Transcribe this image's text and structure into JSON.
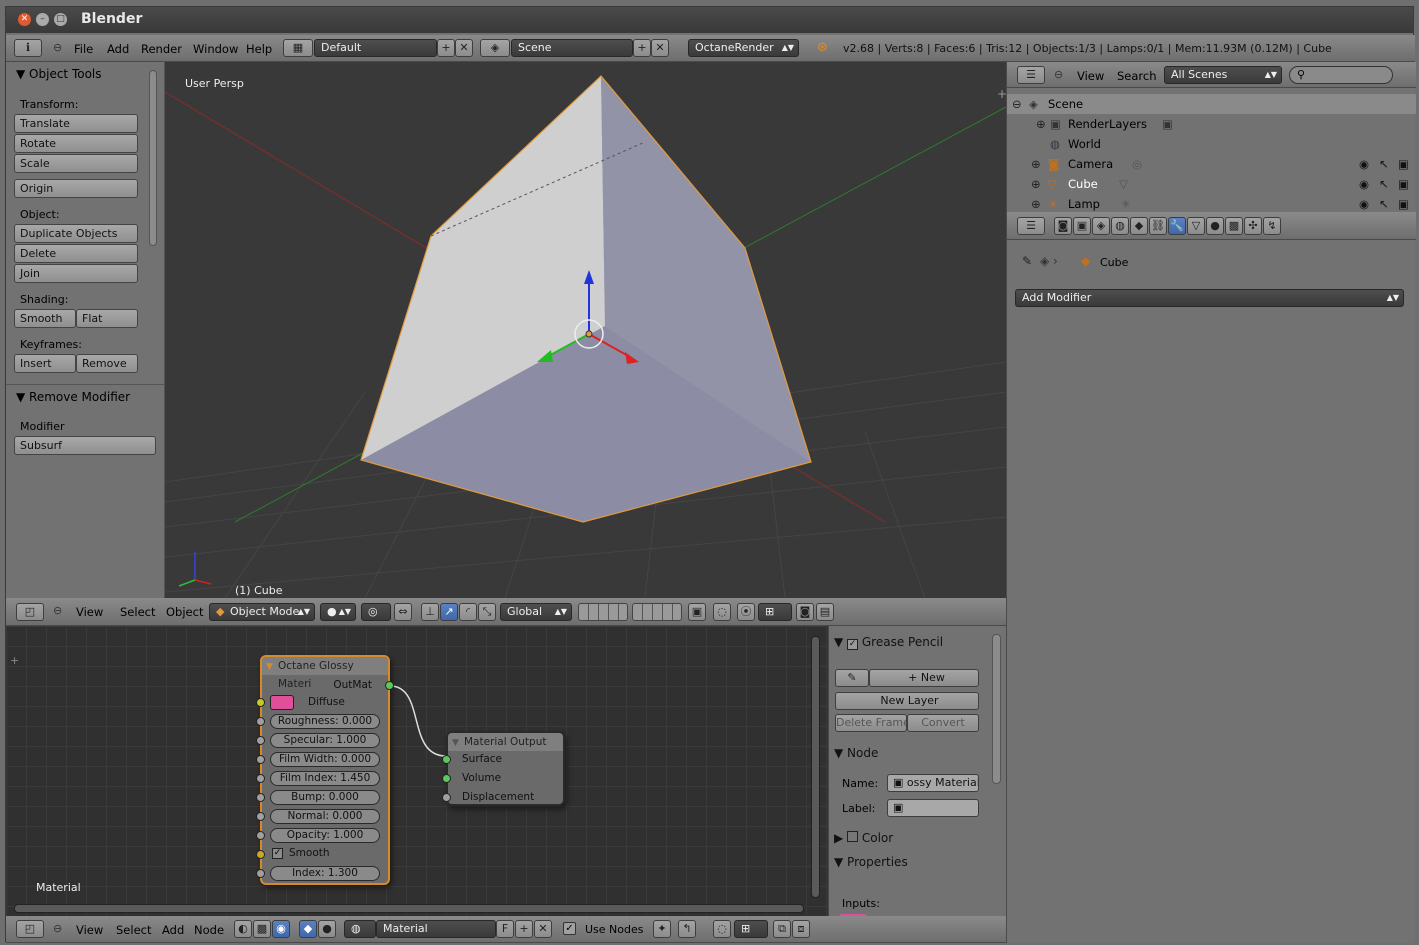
{
  "window": {
    "title": "Blender"
  },
  "infobar": {
    "menus": [
      "File",
      "Add",
      "Render",
      "Window",
      "Help"
    ],
    "screen_layout": "Default",
    "scene": "Scene",
    "render_engine": "OctaneRender",
    "stats": "v2.68 | Verts:8 | Faces:6 | Tris:12 | Objects:1/3 | Lamps:0/1 | Mem:11.93M (0.12M) | Cube"
  },
  "toolshelf": {
    "panel_title": "Object Tools",
    "transform_label": "Transform:",
    "translate": "Translate",
    "rotate": "Rotate",
    "scale": "Scale",
    "origin": "Origin",
    "object_label": "Object:",
    "duplicate": "Duplicate Objects",
    "delete": "Delete",
    "join": "Join",
    "shading_label": "Shading:",
    "smooth": "Smooth",
    "flat": "Flat",
    "keyframes_label": "Keyframes:",
    "insert": "Insert",
    "remove": "Remove",
    "operator_panel_title": "Remove Modifier",
    "modifier_label": "Modifier",
    "modifier_value": "Subsurf"
  },
  "viewport": {
    "view_label": "User Persp",
    "object_label": "(1) Cube",
    "header": {
      "menus": [
        "View",
        "Select",
        "Object"
      ],
      "mode": "Object Mode",
      "orientation": "Global"
    }
  },
  "outliner": {
    "menus": [
      "View",
      "Search"
    ],
    "display_mode": "All Scenes",
    "search_placeholder": "",
    "items": [
      {
        "name": "Scene"
      },
      {
        "name": "RenderLayers"
      },
      {
        "name": "World"
      },
      {
        "name": "Camera"
      },
      {
        "name": "Cube"
      },
      {
        "name": "Lamp"
      }
    ]
  },
  "properties": {
    "breadcrumb_object": "Cube",
    "add_modifier": "Add Modifier"
  },
  "node_editor": {
    "glossy_node": {
      "title": "Octane Glossy Materi",
      "output": "OutMat",
      "diffuse": "Diffuse",
      "diffuse_color": "#e0509a",
      "fields": [
        "Roughness: 0.000",
        "Specular: 1.000",
        "Film Width: 0.000",
        "Film Index: 1.450",
        "Bump: 0.000",
        "Normal: 0.000",
        "Opacity: 1.000"
      ],
      "smooth": "Smooth",
      "index": "Index: 1.300"
    },
    "output_node": {
      "title": "Material Output",
      "inputs": [
        "Surface",
        "Volume",
        "Displacement"
      ]
    },
    "corner_label": "Material",
    "header": {
      "menus": [
        "View",
        "Select",
        "Add",
        "Node"
      ],
      "material": "Material",
      "fake_user": "F",
      "use_nodes": "Use Nodes"
    }
  },
  "node_sidebar": {
    "grease_pencil": "Grease Pencil",
    "new": "New",
    "new_layer": "New Layer",
    "delete_frame": "Delete Frame",
    "convert": "Convert",
    "node_panel": "Node",
    "name_label": "Name:",
    "name_value": "ossy Material",
    "label_label": "Label:",
    "color_panel": "Color",
    "properties_panel": "Properties",
    "inputs_label": "Inputs:"
  },
  "colors": {
    "accent": "#5680c2",
    "selection_outline": "#d78a2c"
  }
}
